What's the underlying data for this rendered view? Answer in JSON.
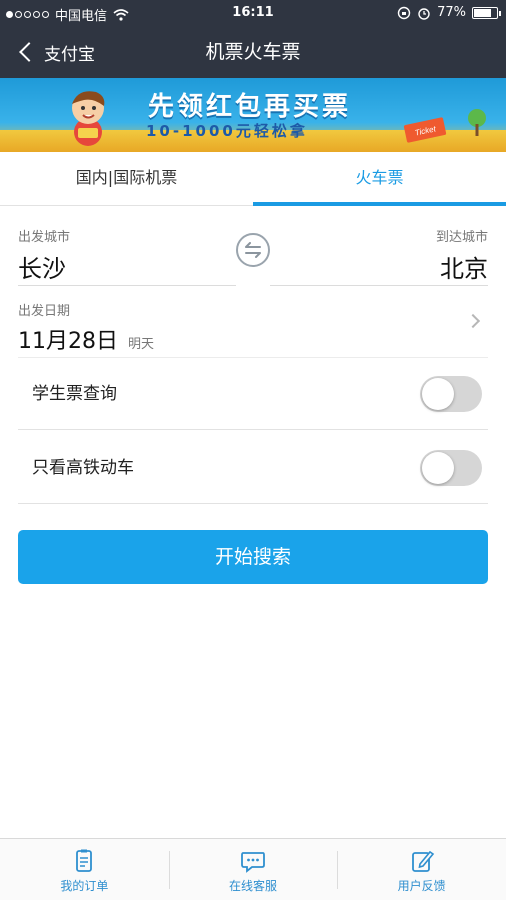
{
  "status_bar": {
    "carrier": "中国电信",
    "time": "16:11",
    "battery_percent": "77%",
    "battery_level": 0.77
  },
  "nav": {
    "back_label": "支付宝",
    "title": "机票火车票"
  },
  "banner": {
    "headline": "先领红包再买票",
    "subline": "10-1000元轻松拿",
    "ticket_text": "Ticket"
  },
  "tabs": [
    {
      "label": "国内|国际机票",
      "active": false
    },
    {
      "label": "火车票",
      "active": true
    }
  ],
  "route": {
    "from_label": "出发城市",
    "from_city": "长沙",
    "to_label": "到达城市",
    "to_city": "北京"
  },
  "date": {
    "label": "出发日期",
    "value": "11月28日",
    "note": "明天"
  },
  "options": [
    {
      "label": "学生票查询",
      "on": false
    },
    {
      "label": "只看高铁动车",
      "on": false
    }
  ],
  "search_button": "开始搜索",
  "bottom_nav": [
    {
      "label": "我的订单",
      "icon": "order-list-icon"
    },
    {
      "label": "在线客服",
      "icon": "chat-bubble-icon"
    },
    {
      "label": "用户反馈",
      "icon": "feedback-edit-icon"
    }
  ],
  "colors": {
    "header_bg": "#2f3541",
    "accent": "#1a9be3",
    "button": "#1aa3ea",
    "toggle_off": "#d6d6d6"
  }
}
